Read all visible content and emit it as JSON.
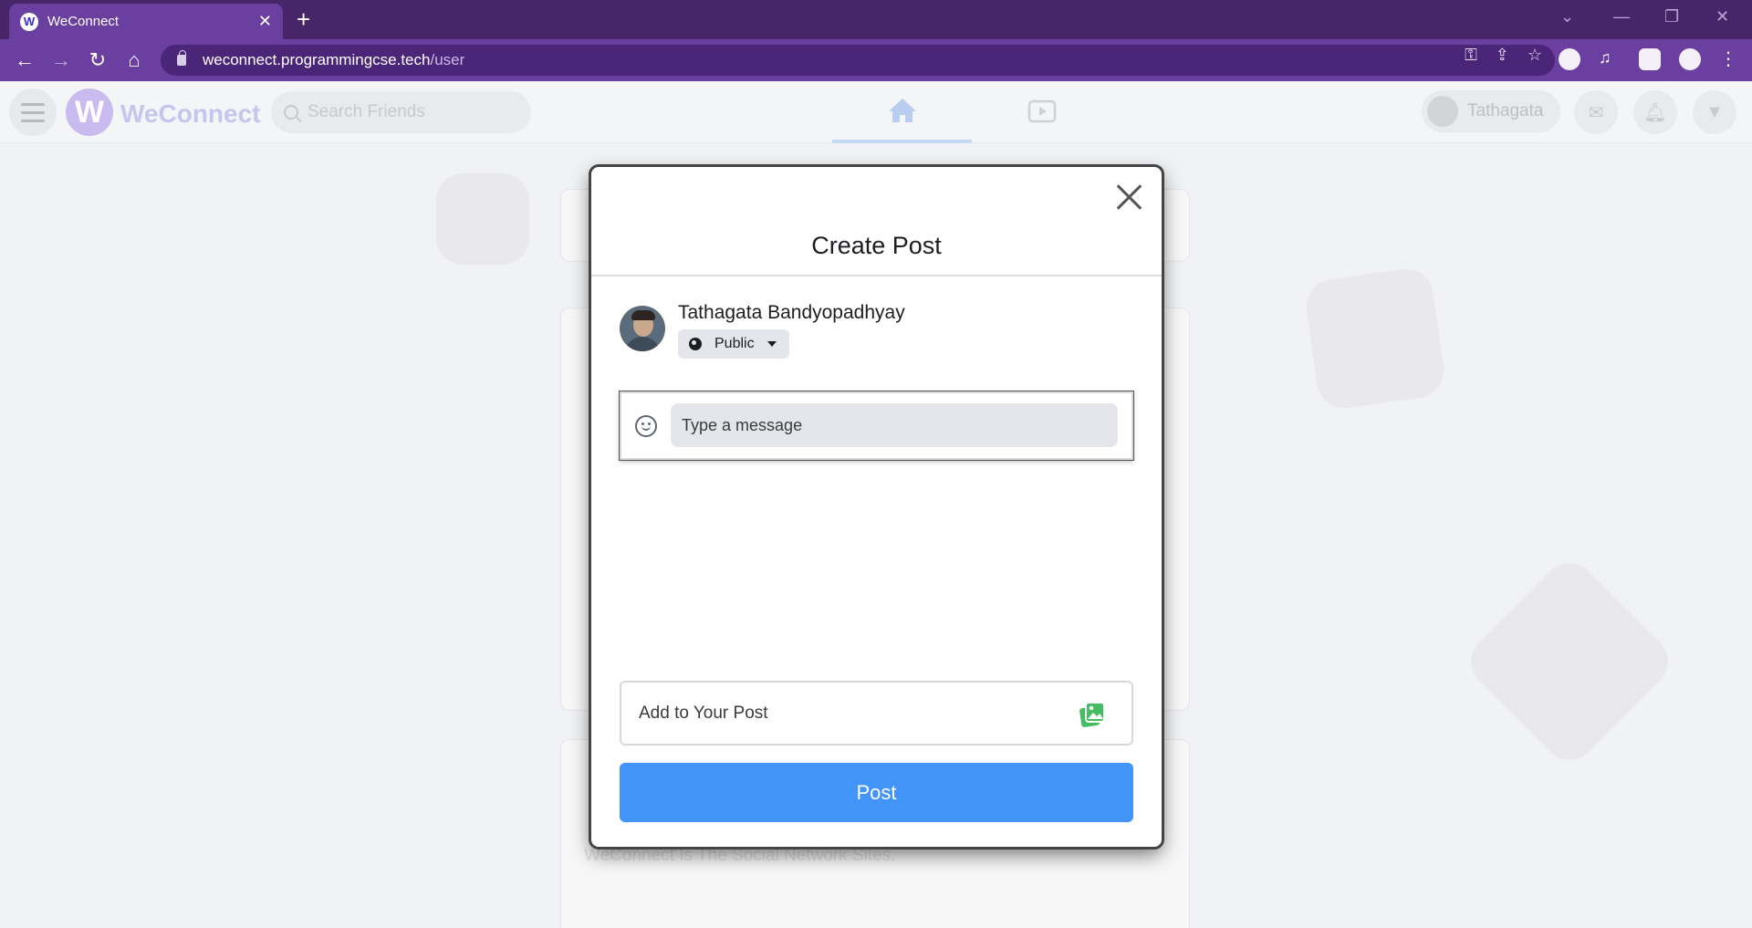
{
  "browser": {
    "tab_title": "WeConnect",
    "tab_favicon": "W",
    "url_host": "weconnect.programmingcse.tech",
    "url_path": "/user"
  },
  "app": {
    "logo_letter": "W",
    "logo_text": "WeConnect",
    "search_placeholder": "Search Friends",
    "user_name_short": "Tathagata",
    "background_caption": "WeConnect Is The Social Network Sites."
  },
  "modal": {
    "title": "Create Post",
    "user_name": "Tathagata Bandyopadhyay",
    "privacy_label": "Public",
    "message_placeholder": "Type a message",
    "add_to_post_label": "Add to Your Post",
    "post_button_label": "Post"
  },
  "colors": {
    "tabbar": "#482568",
    "addressbar": "#6a3fa0",
    "post_button": "#4294f8",
    "photo_icon": "#45bd62"
  }
}
